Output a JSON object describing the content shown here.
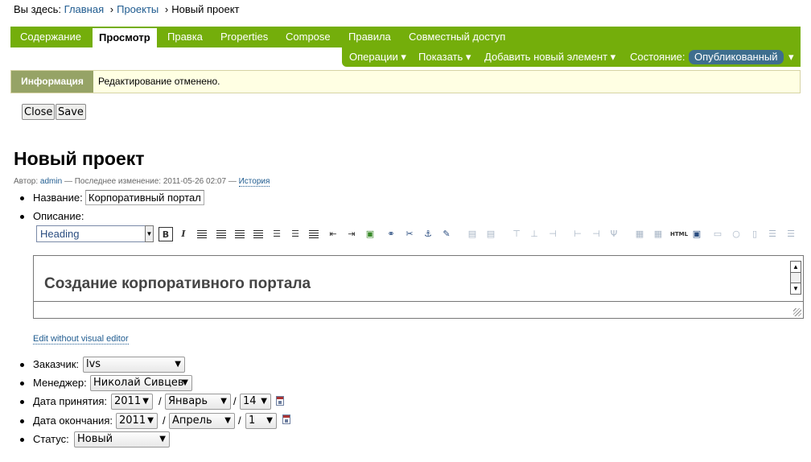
{
  "breadcrumbs": {
    "prefix": "Вы здесь:",
    "items": [
      "Главная",
      "Проекты"
    ],
    "sep": "›",
    "current": "Новый проект"
  },
  "tabs": [
    "Содержание",
    "Просмотр",
    "Правка",
    "Properties",
    "Compose",
    "Правила",
    "Совместный доступ"
  ],
  "active_tab": "Просмотр",
  "actions": {
    "operations": "Операции ▾",
    "display": "Показать ▾",
    "add_new": "Добавить новый элемент ▾",
    "state_label": "Состояние:",
    "state_value": "Опубликованный",
    "state_arrow": "▾"
  },
  "info": {
    "label": "Информация",
    "message": "Редактирование отменено."
  },
  "buttons": {
    "close": "Close",
    "save": "Save"
  },
  "page": {
    "title": "Новый проект",
    "byline": {
      "author_prefix": "Автор:",
      "author": "admin",
      "modified": "— Последнее изменение: 2011-05-26 02:07 —",
      "history": "История"
    }
  },
  "form": {
    "name_label": "Название:",
    "name_value": "Корпоративный портал",
    "description_label": "Описание:",
    "format_select": "Heading",
    "editor_content": "Создание корпоративного портала",
    "edit_without_visual": "Edit without visual editor",
    "customer_label": "Заказчик:",
    "customer_value": "lvs",
    "manager_label": "Менеджер:",
    "manager_value": "Николай Сивцев",
    "accepted_label": "Дата принятия:",
    "accepted": {
      "year": "2011",
      "month": "Январь",
      "day": "14"
    },
    "finish_label": "Дата окончания:",
    "finish": {
      "year": "2011",
      "month": "Апрель",
      "day": "1"
    },
    "status_label": "Статус:",
    "status_value": "Новый",
    "date_sep": "/"
  },
  "toolbar_icons": [
    "bold-icon",
    "italic-icon",
    "align-left-icon",
    "align-center-icon",
    "align-right-icon",
    "justify-icon",
    "bullet-list-icon",
    "numbered-list-icon",
    "indent-icon",
    "outdent-icon",
    "outdent-alt-icon",
    "image-icon",
    "link-icon",
    "unlink-icon",
    "anchor-icon",
    "edit-icon",
    "html-icon"
  ]
}
